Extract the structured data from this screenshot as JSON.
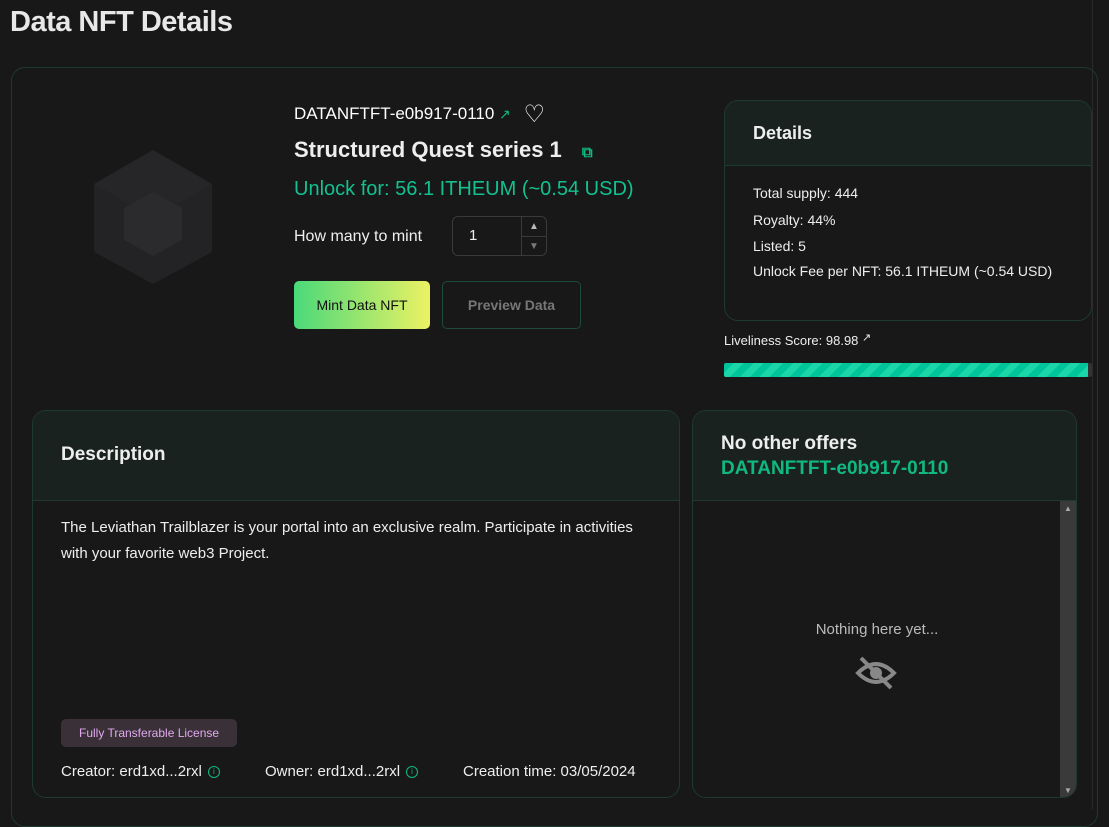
{
  "page_title": "Data NFT Details",
  "nft": {
    "token_id": "DATANFTFT-e0b917-0110",
    "name": "Structured Quest series 1",
    "unlock": "Unlock for: 56.1 ITHEUM (~0.54 USD)",
    "mint_label": "How many to mint",
    "mint_qty": "1",
    "mint_button": "Mint Data NFT",
    "preview_button": "Preview Data"
  },
  "details": {
    "title": "Details",
    "items": [
      "Total supply: 444",
      "Royalty: 44%",
      "Listed: 5",
      "Unlock Fee per NFT: 56.1 ITHEUM (~0.54 USD)"
    ]
  },
  "liveliness": {
    "label": "Liveliness Score: 98.98",
    "percent": 98.98
  },
  "description": {
    "title": "Description",
    "text": "The Leviathan Trailblazer is your portal into an exclusive realm. Participate in activities with your favorite web3 Project.",
    "license": "Fully Transferable License",
    "creator": "Creator: erd1xd...2rxl",
    "owner": "Owner: erd1xd...2rxl",
    "created": "Creation time: 03/05/2024"
  },
  "offers": {
    "title": "No other offers",
    "token_id": "DATANFTFT-e0b917-0110",
    "empty": "Nothing here yet..."
  },
  "colors": {
    "accent": "#10b981",
    "border": "#1e3a30",
    "background": "#181818"
  }
}
